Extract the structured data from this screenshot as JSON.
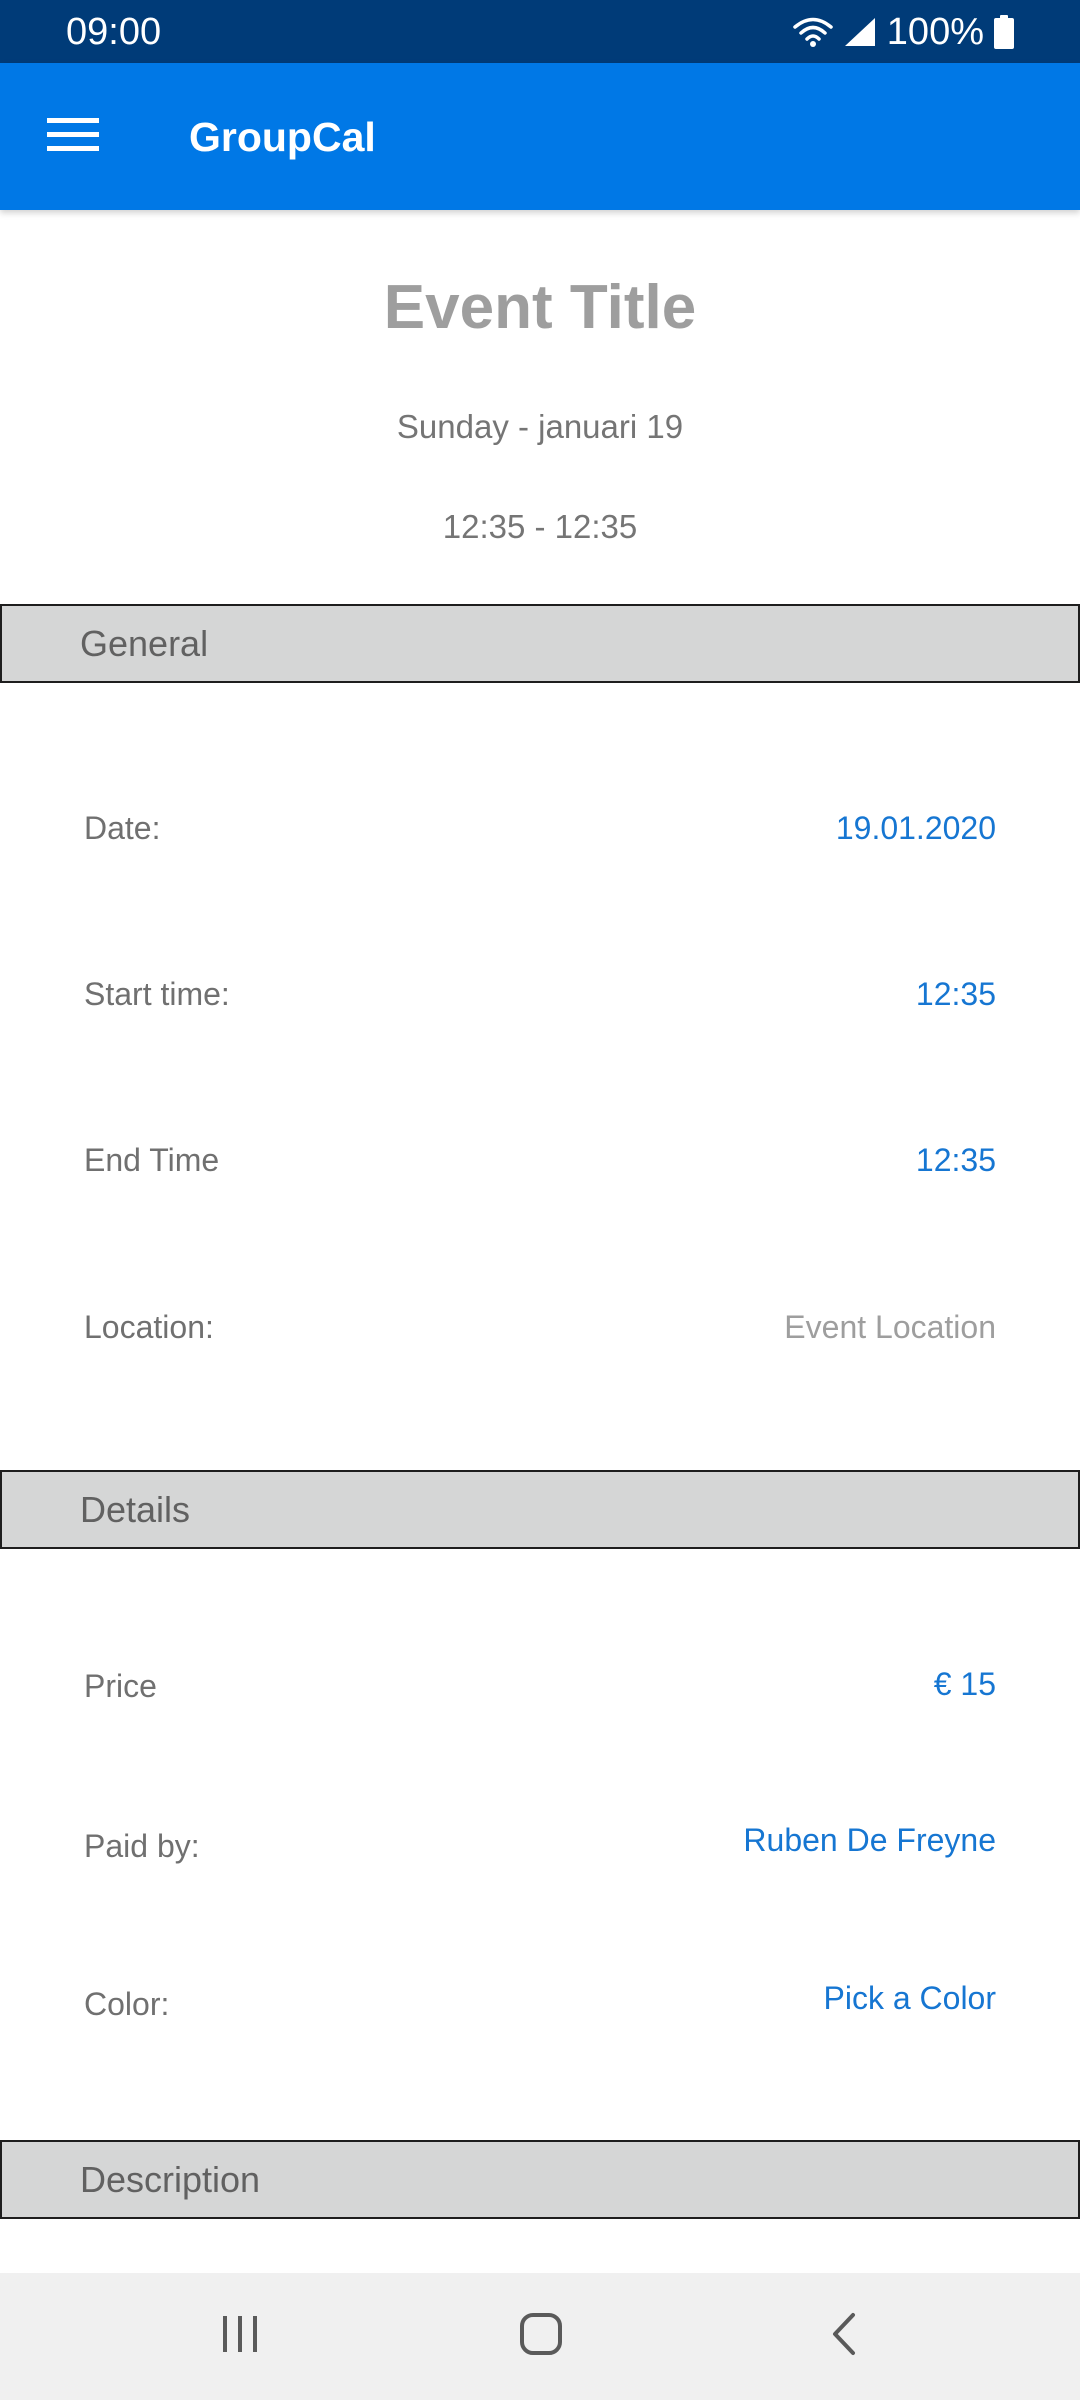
{
  "status_bar": {
    "time": "09:00",
    "battery": "100%",
    "icons": [
      "wifi-icon",
      "signal-icon",
      "battery-icon"
    ]
  },
  "app_bar": {
    "title": "GroupCal",
    "menu_icon": "hamburger-menu-icon"
  },
  "event": {
    "title": "Event Title",
    "date_line": "Sunday - januari 19",
    "time_line": "12:35 - 12:35"
  },
  "sections": {
    "general": "General",
    "details": "Details",
    "description": "Description"
  },
  "general": {
    "date_label": "Date:",
    "date_value": "19.01.2020",
    "start_label": "Start time:",
    "start_value": "12:35",
    "end_label": "End Time",
    "end_value": "12:35",
    "location_label": "Location:",
    "location_placeholder": "Event Location"
  },
  "details": {
    "price_label": "Price",
    "price_value": "€ 15",
    "paid_label": "Paid by:",
    "paid_value": "Ruben De Freyne",
    "color_label": "Color:",
    "color_value": "Pick a Color"
  },
  "nav_bar": {
    "icons": [
      "recent-apps-icon",
      "home-icon",
      "back-icon"
    ]
  },
  "colors": {
    "status_bar": "#003b78",
    "app_bar": "#0078e6",
    "accent_value": "#1676d2",
    "section_header": "#d5d6d6"
  }
}
